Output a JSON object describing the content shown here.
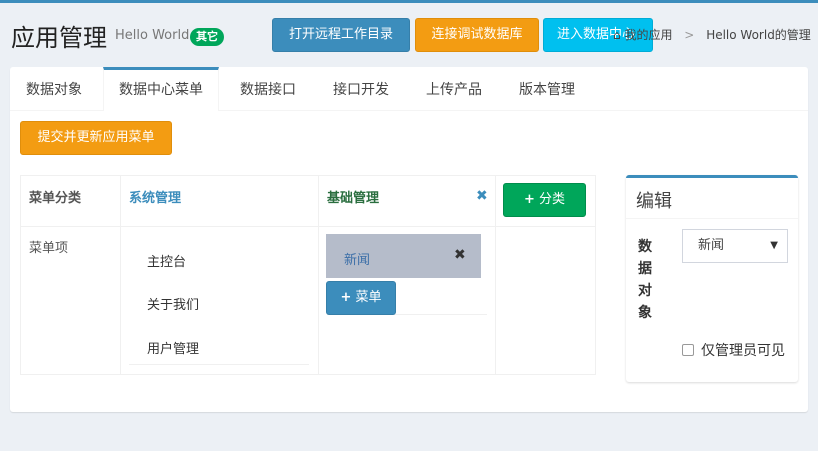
{
  "header": {
    "title": "应用管理",
    "subtitle": "Hello World",
    "badge": "其它",
    "buttons": {
      "remote_dir": "打开远程工作目录",
      "connect_db": "连接调试数据库",
      "data_center": "进入数据中心"
    },
    "breadcrumb": {
      "home": "我的应用",
      "separator": ">",
      "current": "Hello World的管理"
    }
  },
  "tabs": [
    {
      "label": "数据对象"
    },
    {
      "label": "数据中心菜单",
      "active": true
    },
    {
      "label": "数据接口"
    },
    {
      "label": "接口开发"
    },
    {
      "label": "上传产品"
    },
    {
      "label": "版本管理"
    }
  ],
  "actions": {
    "submit_label": "提交并更新应用菜单"
  },
  "menu_editor": {
    "category_header": "菜单分类",
    "item_header": "菜单项",
    "categories": [
      {
        "name": "系统管理",
        "items": [
          "主控台",
          "关于我们",
          "用户管理"
        ]
      },
      {
        "name": "基础管理",
        "items": [
          "新闻"
        ]
      }
    ],
    "add_category_label": "分类",
    "add_menu_label": "菜单"
  },
  "edit_panel": {
    "title": "编辑",
    "field_label": "数据对象",
    "field_value": "新闻",
    "checkbox_label": "仅管理员可见",
    "checkbox_checked": false
  },
  "colors": {
    "primary": "#3c8dbc",
    "warning": "#f39c12",
    "info": "#00c0ef",
    "success": "#00a65a",
    "category_text": "#3c8dbc",
    "category2_text": "#2a6e3f",
    "selected_item_bg": "#b5bcca"
  },
  "icons": {
    "home": "home-icon",
    "close": "close-icon",
    "plus": "plus-icon",
    "caret": "caret-down-icon"
  }
}
